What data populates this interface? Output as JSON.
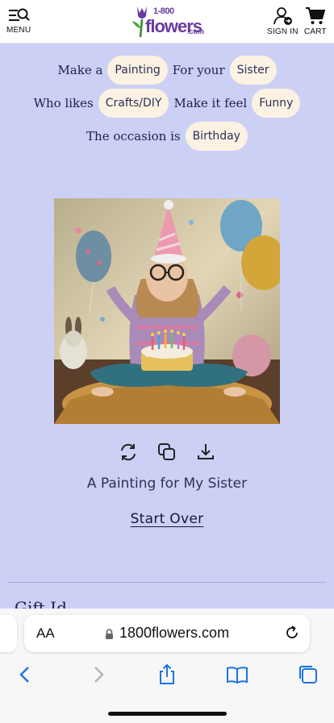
{
  "header": {
    "menu_label": "MENU",
    "signin_label": "SIGN IN",
    "cart_label": "CART",
    "logo_number": "1-800",
    "logo_word": "flowers",
    "logo_suffix": ".com"
  },
  "builder": {
    "row1_text1": "Make a",
    "row1_choice1": "Painting",
    "row1_text2": "For your",
    "row1_choice2": "Sister",
    "row2_text1": "Who likes",
    "row2_choice1": "Crafts/DIY",
    "row2_text2": "Make it feel",
    "row2_choice2": "Funny",
    "row3_text1": "The occasion is",
    "row3_choice1": "Birthday"
  },
  "result": {
    "caption": "A Painting for My Sister",
    "start_over": "Start Over"
  },
  "next_section": {
    "peek_title": "Gift Id"
  },
  "browser": {
    "aa_label": "AA",
    "url": "1800flowers.com"
  },
  "colors": {
    "page_bg": "#ccd0f5",
    "pill_bg": "#fbf2e3",
    "brand_purple": "#6a3aa0",
    "safari_blue": "#1a73e8"
  },
  "icons": [
    "menu-search-icon",
    "account-icon",
    "cart-icon",
    "regenerate-icon",
    "copy-icon",
    "download-icon",
    "lock-icon",
    "reload-icon",
    "back-icon",
    "forward-icon",
    "share-icon",
    "bookmarks-icon",
    "tabs-icon"
  ]
}
